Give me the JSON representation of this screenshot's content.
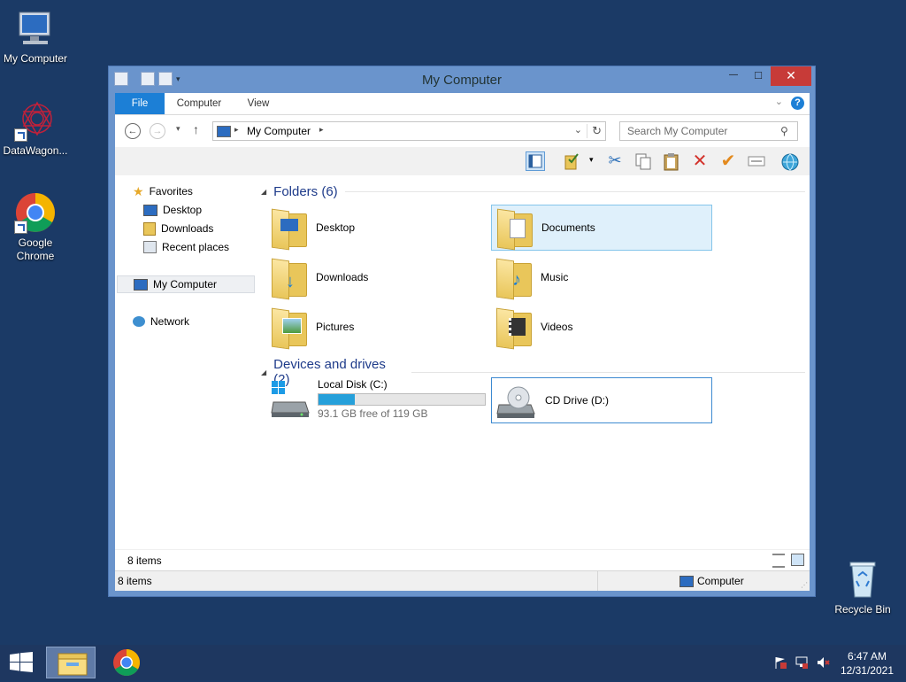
{
  "desktop": {
    "icons": [
      {
        "label": "My Computer"
      },
      {
        "label": "DataWagon..."
      },
      {
        "label": "Google Chrome"
      },
      {
        "label": "Recycle Bin"
      }
    ]
  },
  "window": {
    "title": "My Computer",
    "ribbon_tabs": [
      "File",
      "Computer",
      "View"
    ],
    "address": "My Computer",
    "search_placeholder": "Search My Computer",
    "close_glyph": "✕",
    "max_glyph": "□",
    "min_glyph": "—"
  },
  "nav": {
    "favorites": "Favorites",
    "desktop": "Desktop",
    "downloads": "Downloads",
    "recent": "Recent places",
    "computer": "My Computer",
    "network": "Network"
  },
  "main": {
    "folders_header": "Folders (6)",
    "folders": [
      "Desktop",
      "Documents",
      "Downloads",
      "Music",
      "Pictures",
      "Videos"
    ],
    "drives_header": "Devices and drives (2)",
    "drive_c": {
      "name": "Local Disk (C:)",
      "free": "93.1 GB free of 119 GB",
      "used_fraction": 0.22
    },
    "drive_d": {
      "name": "CD Drive (D:)"
    }
  },
  "status": {
    "inner_count": "8 items",
    "bar_count": "8 items",
    "location": "Computer"
  },
  "taskbar": {
    "time": "6:47 AM",
    "date": "12/31/2021"
  },
  "colors": {
    "desktop_bg": "#1b3a66",
    "accent": "#1c7fd6",
    "close_red": "#c73b38",
    "progress": "#26a0da"
  }
}
